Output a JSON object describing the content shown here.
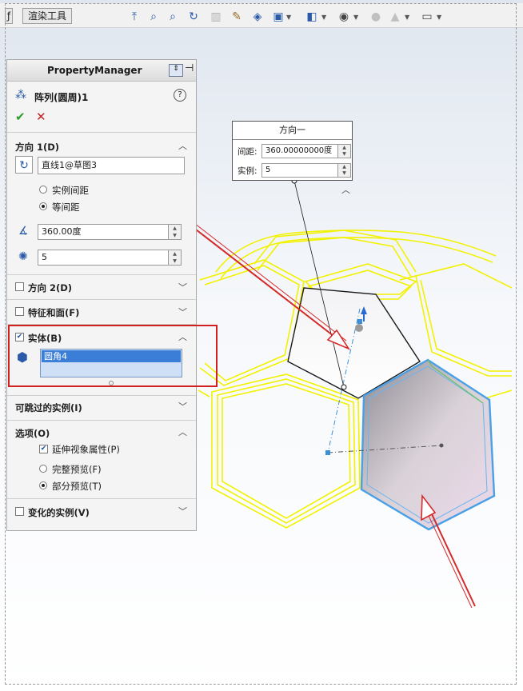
{
  "toolbar": {
    "tab_left": "ƒ",
    "tab_render": "渲染工具",
    "icons": [
      "pointer-icon",
      "zoom-fit-icon",
      "zoom-area-icon",
      "rotate-icon",
      "section-icon",
      "appearance-icon",
      "cube-icon",
      "display-style-icon",
      "view-orient-icon",
      "hide-show-icon",
      "scene-icon",
      "monitor-icon"
    ]
  },
  "pm": {
    "header": "PropertyManager",
    "feature_title": "阵列(圆周)1",
    "help": "?",
    "ok": "✔",
    "cancel": "✕",
    "direction1": {
      "title": "方向 1(D)",
      "axis": "直线1@草图3",
      "radio_instance_spacing": "实例间距",
      "radio_equal_spacing": "等间距",
      "angle": "360.00度",
      "count": "5"
    },
    "direction2": "方向 2(D)",
    "features_faces": "特征和面(F)",
    "bodies": {
      "title": "实体(B)",
      "item": "圆角4"
    },
    "skip_instances": "可跳过的实例(I)",
    "options": {
      "title": "选项(O)",
      "propagate": "延伸视象属性(P)",
      "full_preview": "完整预览(F)",
      "partial_preview": "部分预览(T)"
    },
    "vary": "变化的实例(V)"
  },
  "callout": {
    "title": "方向一",
    "spacing_label": "间距:",
    "spacing_value": "360.00000000度",
    "instances_label": "实例:",
    "instances_value": "5"
  },
  "colors": {
    "highlight": "#d02020",
    "preview": "#f2f200",
    "selected_body": "#4aa0e6"
  }
}
